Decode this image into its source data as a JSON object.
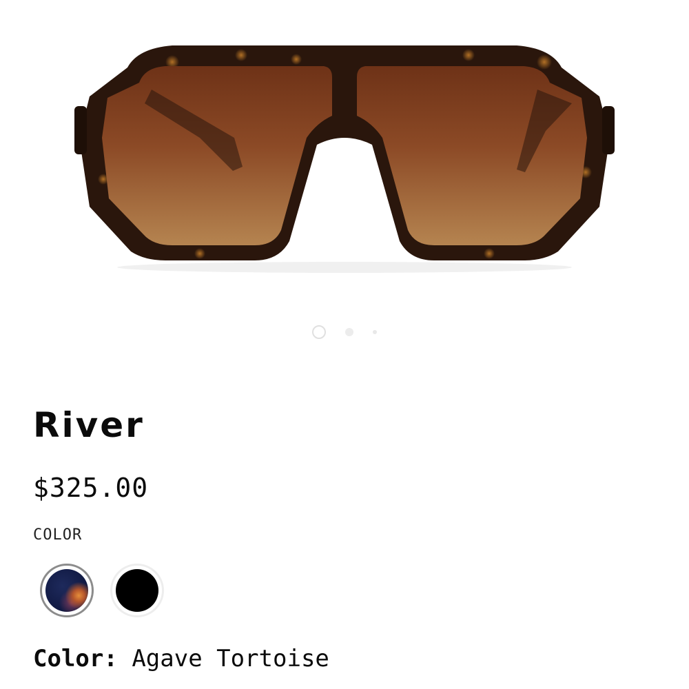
{
  "product": {
    "name": "River",
    "price": "$325.00",
    "color_heading": "COLOR",
    "selected_color_label": "Color:",
    "selected_color_value": "Agave Tortoise",
    "image_alt": "River sunglasses in Agave Tortoise"
  },
  "carousel": {
    "slides": 3,
    "active_index": 0
  },
  "swatches": [
    {
      "name": "Agave Tortoise",
      "color": "#1b2450",
      "selected": true
    },
    {
      "name": "Black",
      "color": "#000000",
      "selected": false
    }
  ],
  "colors": {
    "frame": "#2a160c",
    "lens_top": "#7a3a1c",
    "lens_bottom": "#b27a46",
    "text": "#0b0b0b"
  }
}
